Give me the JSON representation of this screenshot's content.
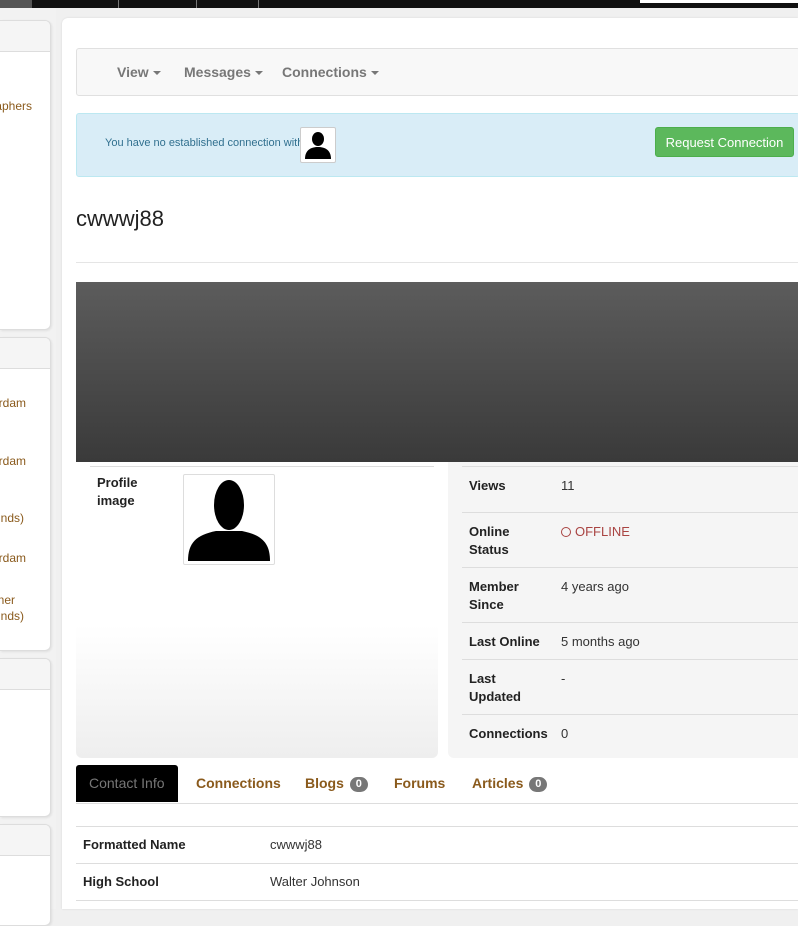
{
  "nav": {
    "view": "View",
    "messages": "Messages",
    "connections": "Connections"
  },
  "sidebar": {
    "links": [
      "aphers",
      "rdam",
      "rdam",
      "nds)",
      "rdam",
      "ner",
      "nds)"
    ]
  },
  "alert": {
    "text": "You have no established connection with",
    "button": "Request Connection"
  },
  "profile": {
    "username": "cwwwj88",
    "image_label": "Profile image"
  },
  "stats": [
    {
      "label": "Views",
      "value": "11"
    },
    {
      "label": "Online Status",
      "value": "OFFLINE"
    },
    {
      "label": "Member Since",
      "value": "4 years ago"
    },
    {
      "label": "Last Online",
      "value": "5 months ago"
    },
    {
      "label": "Last Updated",
      "value": "-"
    },
    {
      "label": "Connections",
      "value": "0"
    }
  ],
  "tabs": {
    "contact_info": "Contact Info",
    "connections": "Connections",
    "blogs": "Blogs",
    "blogs_count": "0",
    "forums": "Forums",
    "articles": "Articles",
    "articles_count": "0"
  },
  "contact": [
    {
      "label": "Formatted Name",
      "value": "cwwwj88"
    },
    {
      "label": "High School",
      "value": "Walter Johnson"
    }
  ],
  "colors": {
    "accent_link": "#8a5a1c",
    "success": "#5cb85c",
    "alert_bg": "#d9edf7",
    "offline": "#a94442"
  },
  "icons": {
    "avatar": "person-silhouette-icon",
    "caret": "caret-down-icon",
    "status": "circle-outline-icon"
  }
}
